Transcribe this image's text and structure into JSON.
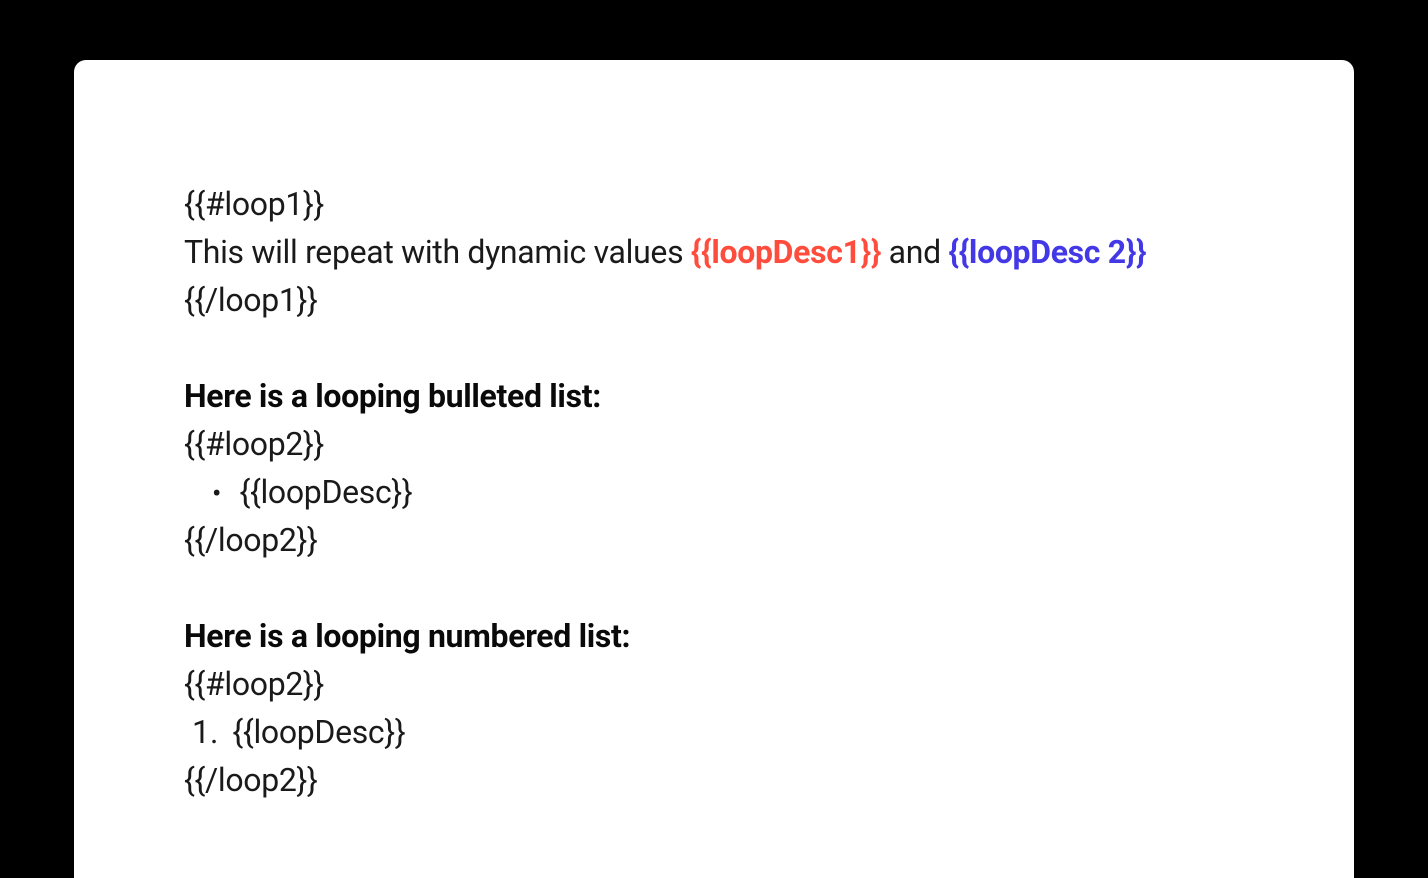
{
  "loop1": {
    "open": "{{#loop1}}",
    "text_prefix": "This will repeat with dynamic values ",
    "var1": "{{loopDesc1}}",
    "text_mid": " and ",
    "var2": "{{loopDesc 2}}",
    "close": "{{/loop1}}"
  },
  "bulleted": {
    "heading": "Here is a looping bulleted list:",
    "open": "{{#loop2}}",
    "bullet": "•",
    "item": "{{loopDesc}}",
    "close": "{{/loop2}}"
  },
  "numbered": {
    "heading": "Here is a looping numbered list:",
    "open": "{{#loop2}}",
    "number": "1.",
    "item": "{{loopDesc}}",
    "close": "{{/loop2}}"
  }
}
